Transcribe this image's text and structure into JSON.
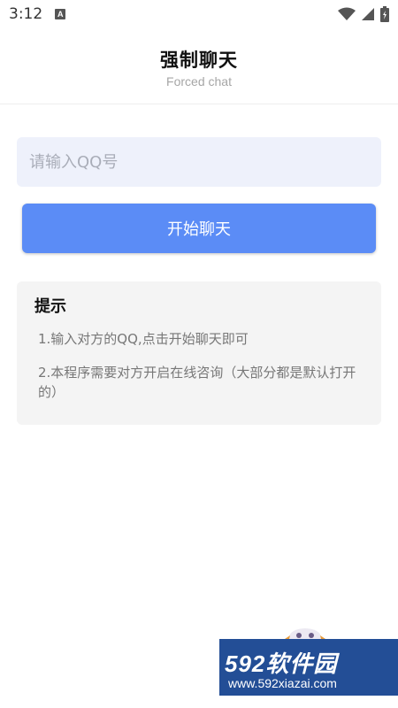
{
  "status_bar": {
    "time": "3:12",
    "badge": "A",
    "icons": [
      "wifi-icon",
      "signal-icon",
      "battery-icon"
    ]
  },
  "header": {
    "title": "强制聊天",
    "subtitle": "Forced chat"
  },
  "form": {
    "qq_input": {
      "placeholder": "请输入QQ号",
      "value": ""
    },
    "start_button_label": "开始聊天"
  },
  "tips": {
    "title": "提示",
    "items": [
      "1.输入对方的QQ,点击开始聊天即可",
      "2.本程序需要对方开启在线咨询（大部分都是默认打开的）"
    ]
  },
  "watermark": {
    "brand": "592软件园",
    "url": "www.592xiazai.com"
  },
  "colors": {
    "accent": "#5b8cf6",
    "input_bg": "#eef1fb",
    "card_bg": "#f4f4f4",
    "watermark_bg": "#234e96"
  }
}
